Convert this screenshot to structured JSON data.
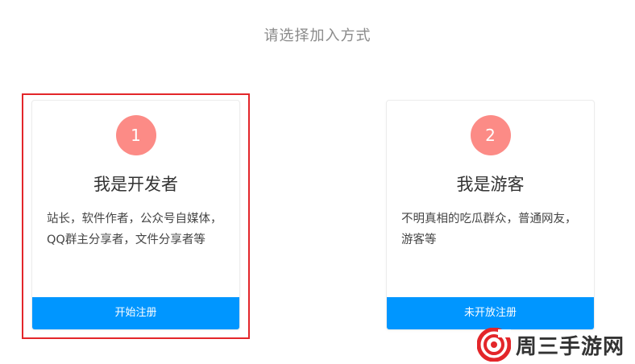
{
  "heading": "请选择加入方式",
  "cards": [
    {
      "number": "1",
      "title": "我是开发者",
      "description": "站长，软件作者，公众号自媒体，QQ群主分享者，文件分享者等",
      "button_label": "开始注册"
    },
    {
      "number": "2",
      "title": "我是游客",
      "description": "不明真相的吃瓜群众，普通网友，游客等",
      "button_label": "未开放注册"
    }
  ],
  "watermark": {
    "text": "周三手游网"
  },
  "colors": {
    "badge": "#fc8b86",
    "button": "#0096ff",
    "highlight": "#e3262a",
    "heading": "#8a8a8a"
  }
}
